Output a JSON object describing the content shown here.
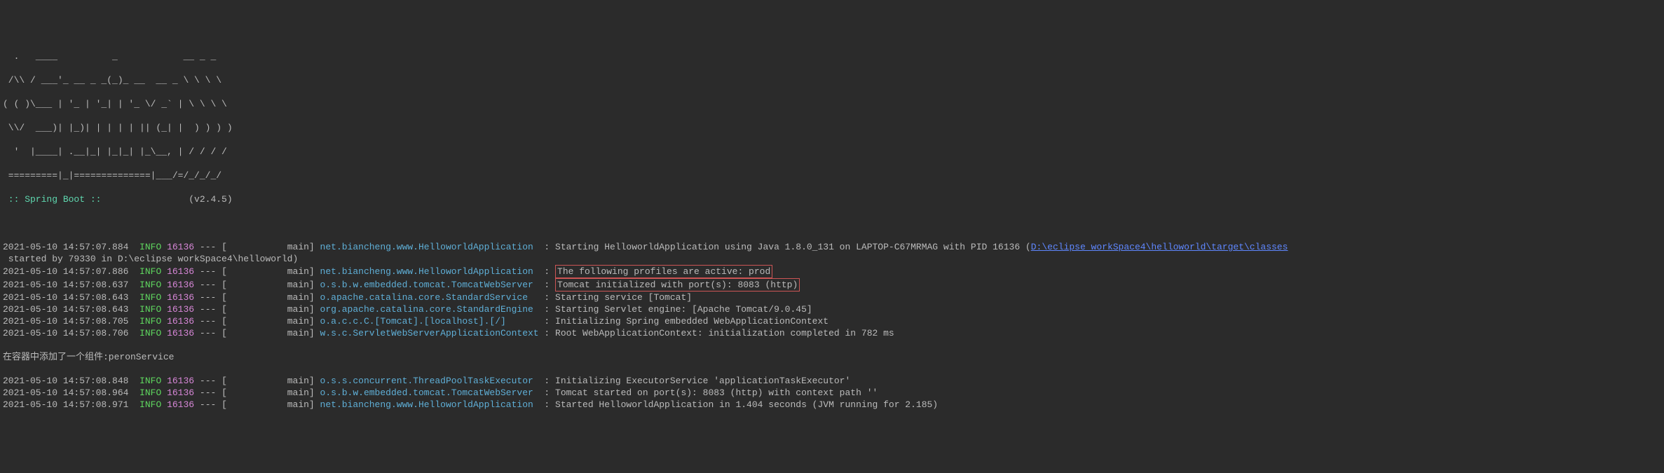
{
  "banner": {
    "l1": "  .   ____          _            __ _ _",
    "l2": " /\\\\ / ___'_ __ _ _(_)_ __  __ _ \\ \\ \\ \\",
    "l3": "( ( )\\___ | '_ | '_| | '_ \\/ _` | \\ \\ \\ \\",
    "l4": " \\\\/  ___)| |_)| | | | | || (_| |  ) ) ) )",
    "l5": "  '  |____| .__|_| |_|_| |_\\__, | / / / /",
    "l6": " =========|_|==============|___/=/_/_/_/",
    "label": " :: Spring Boot :: ",
    "version": "               (v2.4.5)"
  },
  "logs": [
    {
      "ts": "2021-05-10 14:57:07.884",
      "level": "INFO",
      "pid": "16136",
      "thread": "main",
      "logger": "net.biancheng.www.HelloworldApplication",
      "msg_prefix": "Starting HelloworldApplication using Java 1.8.0_131 on LAPTOP-C67MRMAG with PID 16136 (",
      "link": "D:\\eclipse workSpace4\\helloworld\\target\\classes",
      "msg_suffix_line": " started by 79330 in D:\\eclipse workSpace4\\helloworld)"
    },
    {
      "ts": "2021-05-10 14:57:07.886",
      "level": "INFO",
      "pid": "16136",
      "thread": "main",
      "logger": "net.biancheng.www.HelloworldApplication",
      "msg": "The following profiles are active: prod"
    },
    {
      "ts": "2021-05-10 14:57:08.637",
      "level": "INFO",
      "pid": "16136",
      "thread": "main",
      "logger": "o.s.b.w.embedded.tomcat.TomcatWebServer",
      "msg": "Tomcat initialized with port(s): 8083 (http)"
    },
    {
      "ts": "2021-05-10 14:57:08.643",
      "level": "INFO",
      "pid": "16136",
      "thread": "main",
      "logger": "o.apache.catalina.core.StandardService",
      "msg": "Starting service [Tomcat]"
    },
    {
      "ts": "2021-05-10 14:57:08.643",
      "level": "INFO",
      "pid": "16136",
      "thread": "main",
      "logger": "org.apache.catalina.core.StandardEngine",
      "msg": "Starting Servlet engine: [Apache Tomcat/9.0.45]"
    },
    {
      "ts": "2021-05-10 14:57:08.705",
      "level": "INFO",
      "pid": "16136",
      "thread": "main",
      "logger": "o.a.c.c.C.[Tomcat].[localhost].[/]",
      "msg": "Initializing Spring embedded WebApplicationContext"
    },
    {
      "ts": "2021-05-10 14:57:08.706",
      "level": "INFO",
      "pid": "16136",
      "thread": "main",
      "logger": "w.s.c.ServletWebServerApplicationContext",
      "msg": "Root WebApplicationContext: initialization completed in 782 ms"
    }
  ],
  "extra_line": "在容器中添加了一个组件:peronService",
  "logs2": [
    {
      "ts": "2021-05-10 14:57:08.848",
      "level": "INFO",
      "pid": "16136",
      "thread": "main",
      "logger": "o.s.s.concurrent.ThreadPoolTaskExecutor",
      "msg": "Initializing ExecutorService 'applicationTaskExecutor'"
    },
    {
      "ts": "2021-05-10 14:57:08.964",
      "level": "INFO",
      "pid": "16136",
      "thread": "main",
      "logger": "o.s.b.w.embedded.tomcat.TomcatWebServer",
      "msg": "Tomcat started on port(s): 8083 (http) with context path ''"
    },
    {
      "ts": "2021-05-10 14:57:08.971",
      "level": "INFO",
      "pid": "16136",
      "thread": "main",
      "logger": "net.biancheng.www.HelloworldApplication",
      "msg": "Started HelloworldApplication in 1.404 seconds (JVM running for 2.185)"
    }
  ],
  "layout": {
    "thread_width": 15,
    "logger_width": 40
  }
}
